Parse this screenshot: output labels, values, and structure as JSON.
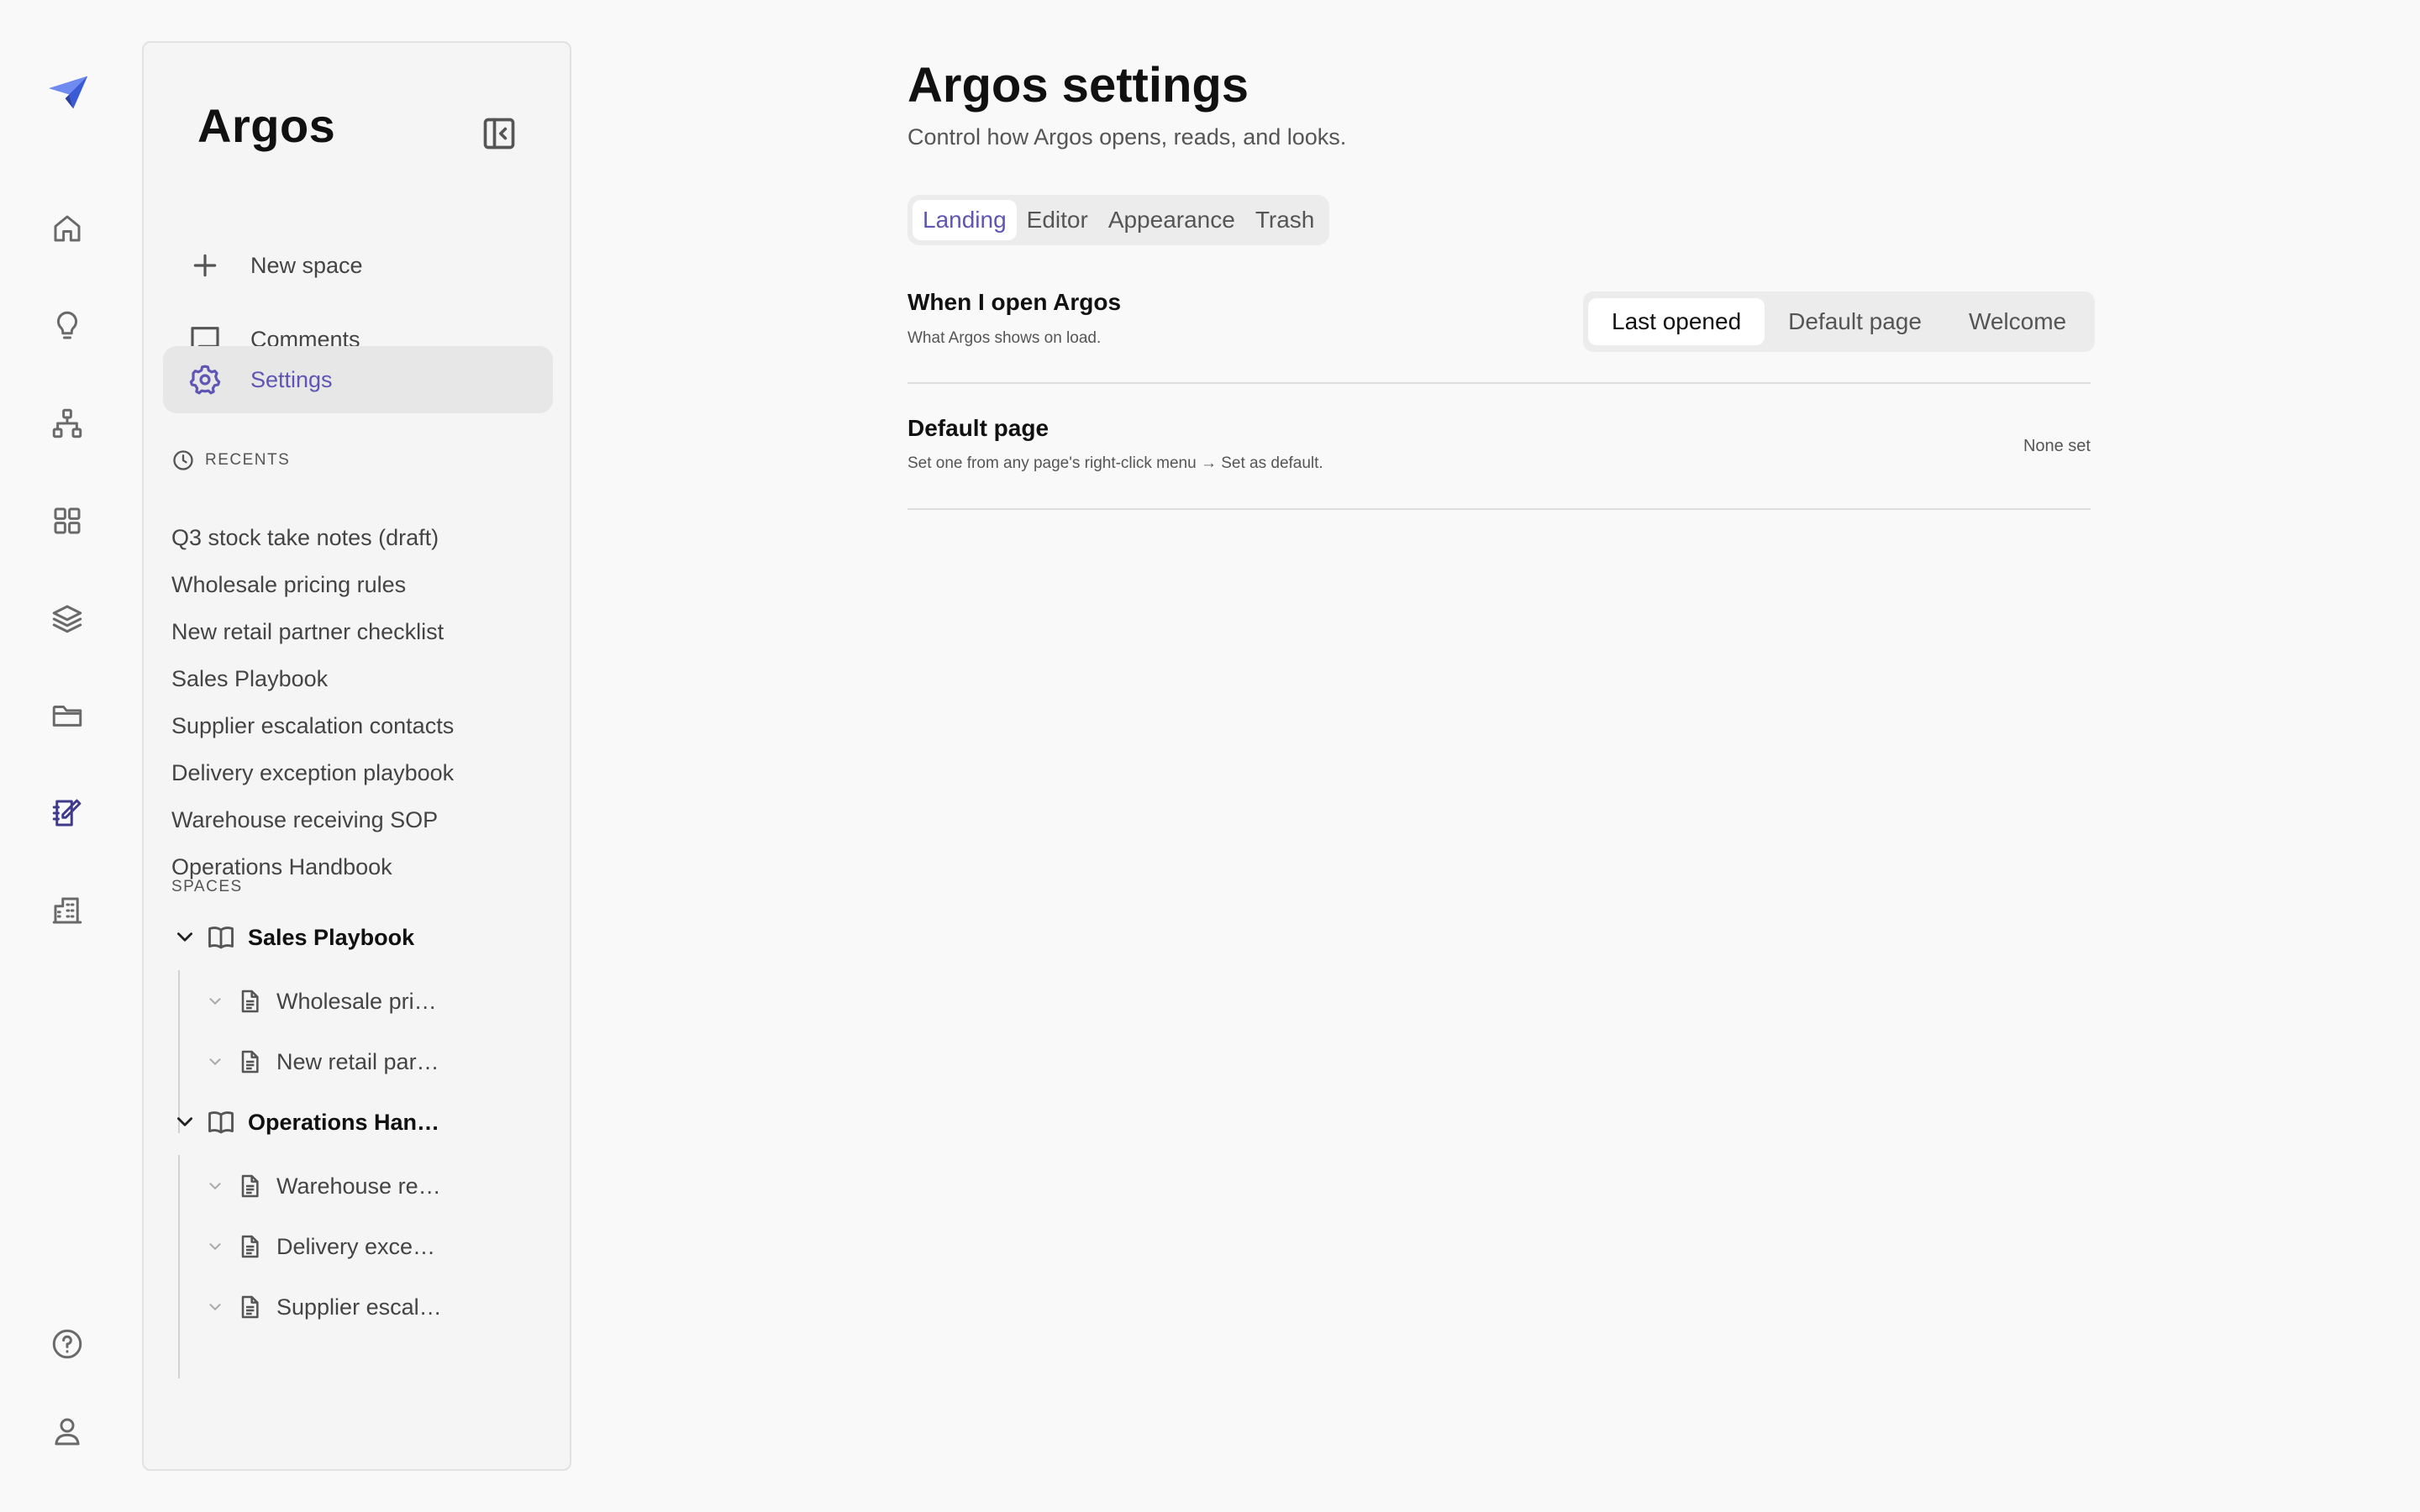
{
  "app": {
    "name": "Argos"
  },
  "rail": {
    "items": [
      {
        "name": "home"
      },
      {
        "name": "ideas"
      },
      {
        "name": "org-chart"
      },
      {
        "name": "apps"
      },
      {
        "name": "layers"
      },
      {
        "name": "folder"
      },
      {
        "name": "notes"
      },
      {
        "name": "building"
      },
      {
        "name": "help"
      },
      {
        "name": "profile"
      }
    ],
    "accent": "#3f3a8c"
  },
  "sidebar": {
    "title": "Argos",
    "nav": [
      {
        "label": "New space",
        "icon": "plus-icon"
      },
      {
        "label": "Comments",
        "icon": "comment-icon"
      },
      {
        "label": "Settings",
        "icon": "gear-icon"
      }
    ],
    "recents_heading": "RECENTS",
    "recents": [
      "Q3 stock take notes (draft)",
      "Wholesale pricing rules",
      "New retail partner checklist",
      "Sales Playbook",
      "Supplier escalation contacts",
      "Delivery exception playbook",
      "Warehouse receiving SOP",
      "Operations Handbook"
    ],
    "spaces_heading": "SPACES",
    "spaces": [
      {
        "name": "Sales Playbook",
        "pages": [
          "Wholesale pri…",
          "New retail par…"
        ]
      },
      {
        "name": "Operations Han…",
        "pages": [
          "Warehouse re…",
          "Delivery exce…",
          "Supplier escal…"
        ]
      }
    ]
  },
  "main": {
    "title": "Argos settings",
    "subtitle": "Control how Argos opens, reads, and looks.",
    "tabs": [
      "Landing",
      "Editor",
      "Appearance",
      "Trash"
    ],
    "active_tab": "Landing",
    "open_setting": {
      "title": "When I open Argos",
      "desc": "What Argos shows on load.",
      "options": [
        "Last opened",
        "Default page",
        "Welcome"
      ],
      "selected": "Last opened"
    },
    "default_page": {
      "title": "Default page",
      "desc": "Set one from any page's right-click menu → Set as default.",
      "value": "None set"
    }
  },
  "colors": {
    "accent": "#5e55b5",
    "background": "#f9f9f9"
  }
}
